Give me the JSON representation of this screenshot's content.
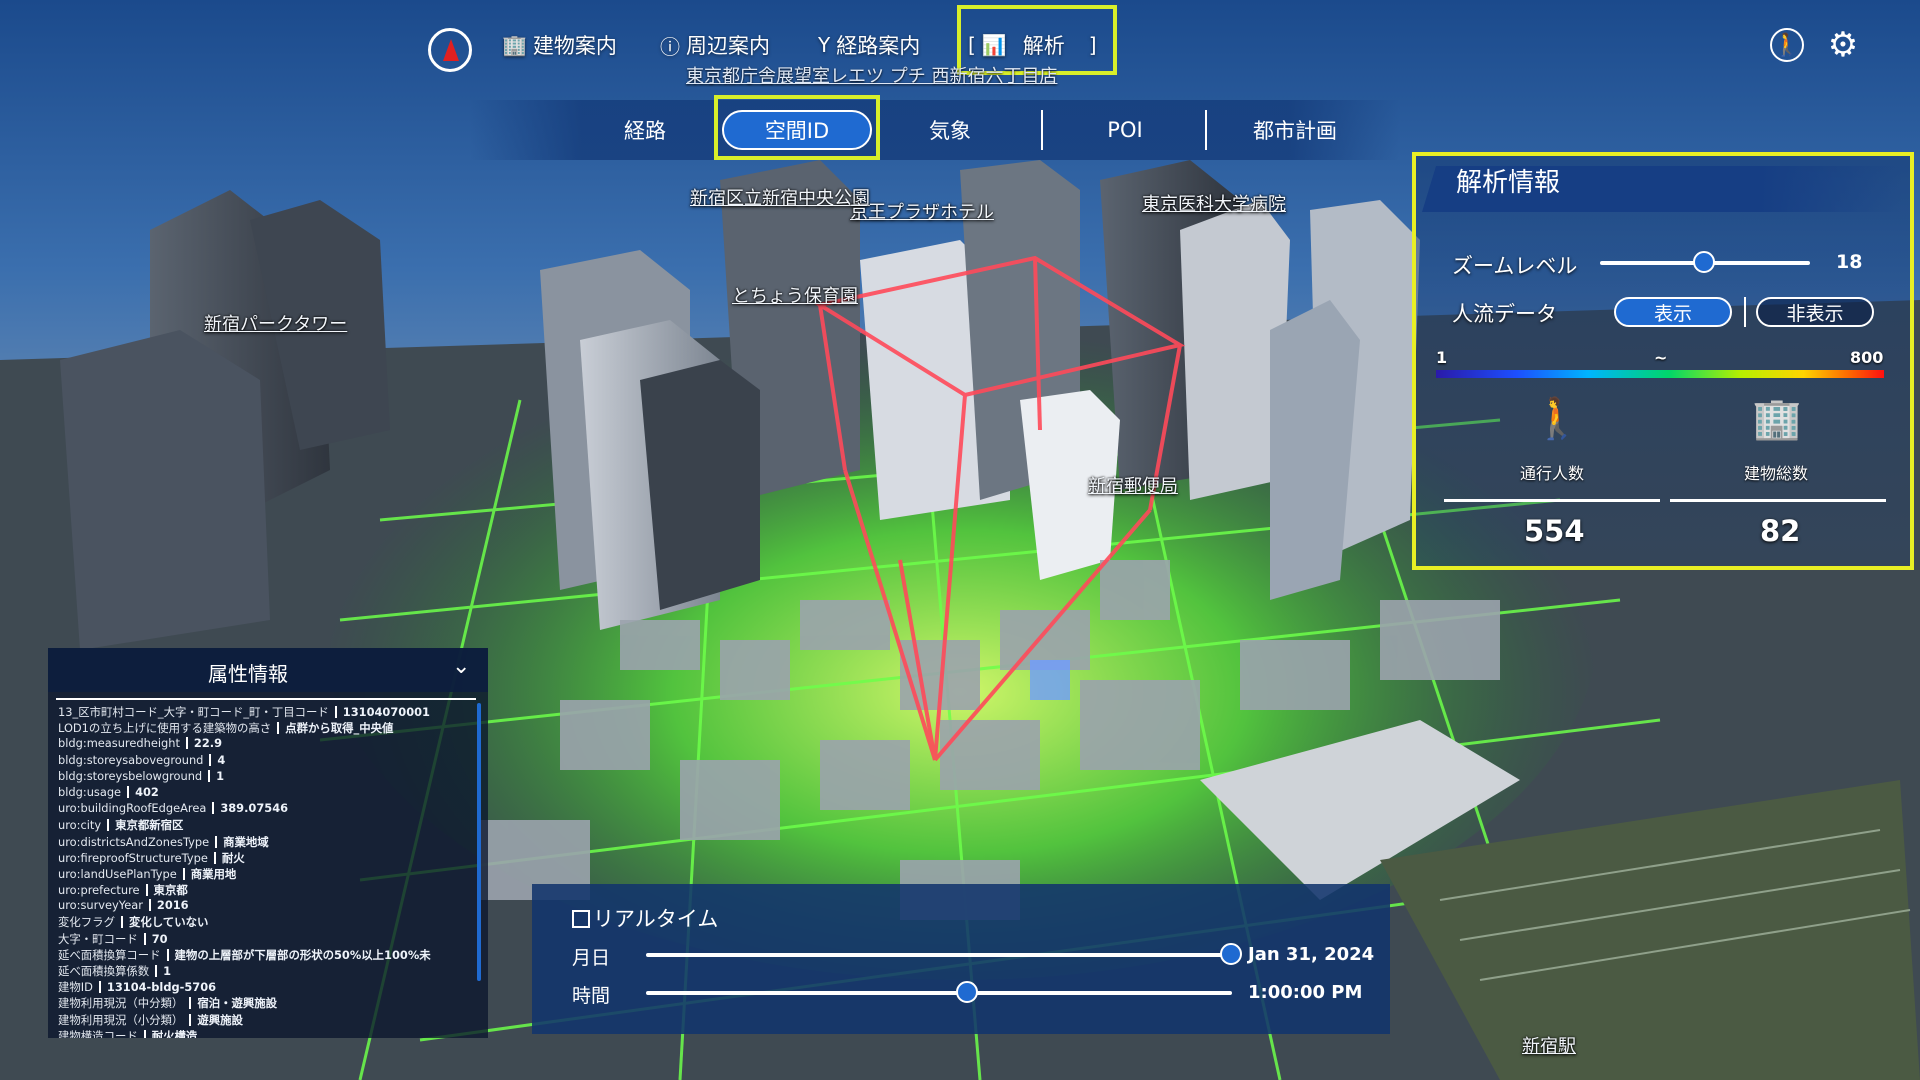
{
  "nav": {
    "items": [
      {
        "label": "建物案内",
        "icon": "building-icon"
      },
      {
        "label": "周辺案内",
        "icon": "info-icon"
      },
      {
        "label": "経路案内",
        "icon": "route-icon"
      },
      {
        "label": "解析",
        "icon": "analysis-chart-icon"
      }
    ],
    "subtitle": "東京都庁舎展望室レエツ プチ 西新宿六丁目店"
  },
  "tabs": [
    "経路",
    "空間ID",
    "気象",
    "POI",
    "都市計画"
  ],
  "active_tab": "空間ID",
  "map_labels": [
    "新宿区立新宿中央公園",
    "京王プラザホテル",
    "東京医科大学病院",
    "とちょう保育園",
    "新宿パークタワー",
    "新宿郵便局",
    "新宿駅"
  ],
  "analysis": {
    "title": "解析情報",
    "zoom_label": "ズームレベル",
    "zoom_value": "18",
    "zoom_level_fraction": 0.5,
    "flow_label": "人流データ",
    "show_label": "表示",
    "hide_label": "非表示",
    "legend_min": "1",
    "legend_mid": "~",
    "legend_max": "800",
    "pedestrians_label": "通行人数",
    "pedestrians_value": "554",
    "buildings_label": "建物総数",
    "buildings_value": "82"
  },
  "attributes": {
    "title": "属性情報",
    "rows": [
      {
        "k": "13_区市町村コード_大字・町コード_町・丁目コード",
        "v": "13104070001"
      },
      {
        "k": "LOD1の立ち上げに使用する建築物の高さ",
        "v": "点群から取得_中央値"
      },
      {
        "k": "bldg:measuredheight",
        "v": "22.9"
      },
      {
        "k": "bldg:storeysaboveground",
        "v": "4"
      },
      {
        "k": "bldg:storeysbelowground",
        "v": "1"
      },
      {
        "k": "bldg:usage",
        "v": "402"
      },
      {
        "k": "uro:buildingRoofEdgeArea",
        "v": "389.07546"
      },
      {
        "k": "uro:city",
        "v": "東京都新宿区"
      },
      {
        "k": "uro:districtsAndZonesType",
        "v": "商業地域"
      },
      {
        "k": "uro:fireproofStructureType",
        "v": "耐火"
      },
      {
        "k": "uro:landUsePlanType",
        "v": "商業用地"
      },
      {
        "k": "uro:prefecture",
        "v": "東京都"
      },
      {
        "k": "uro:surveyYear",
        "v": "2016"
      },
      {
        "k": "変化フラグ",
        "v": "変化していない"
      },
      {
        "k": "大字・町コード",
        "v": "70"
      },
      {
        "k": "延べ面積換算コード",
        "v": "建物の上層部が下層部の形状の50%以上100%未"
      },
      {
        "k": "延べ面積換算係数",
        "v": "1"
      },
      {
        "k": "建物ID",
        "v": "13104-bldg-5706"
      },
      {
        "k": "建物利用現況（中分類）",
        "v": "宿泊・遊興施設"
      },
      {
        "k": "建物利用現況（小分類）",
        "v": "遊興施設"
      },
      {
        "k": "建物構造コード",
        "v": "耐火構造"
      }
    ]
  },
  "time": {
    "realtime_label": "リアルタイム",
    "date_label": "月日",
    "date_value": "Jan 31, 2024",
    "date_fraction": 1.0,
    "time_label": "時間",
    "time_value": "1:00:00 PM",
    "time_fraction": 0.55
  },
  "colors": {
    "accent_blue": "#1f6ad1",
    "highlight_yellow": "#e9ef24",
    "grid_green": "#4dff3a",
    "cube_red": "#ff4a5a"
  }
}
